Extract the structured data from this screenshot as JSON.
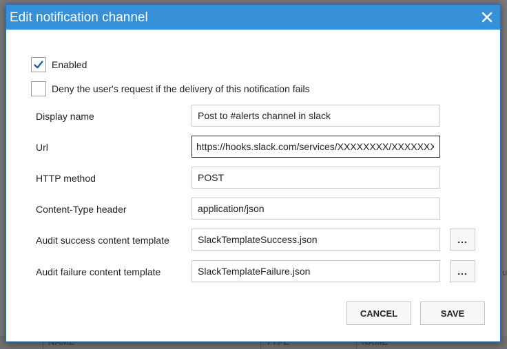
{
  "background": {
    "right_fragment": "u",
    "columns": [
      "NAME",
      "TYPE",
      "NAME"
    ]
  },
  "dialog": {
    "title": "Edit notification channel",
    "close_icon": "close-icon",
    "enabled": {
      "label": "Enabled",
      "checked": true
    },
    "deny": {
      "label": "Deny the user's request if the delivery of this notification fails",
      "checked": false
    },
    "fields": {
      "display_name": {
        "label": "Display name",
        "value": "Post to #alerts channel in slack"
      },
      "url": {
        "label": "Url",
        "value": "https://hooks.slack.com/services/XXXXXXXX/XXXXXXXXX/XXXXXXXXXXXXXXXXXXXXXXXX"
      },
      "http_method": {
        "label": "HTTP method",
        "value": "POST"
      },
      "content_type": {
        "label": "Content-Type header",
        "value": "application/json"
      },
      "success_template": {
        "label": "Audit success content template",
        "value": "SlackTemplateSuccess.json",
        "browse_label": "..."
      },
      "failure_template": {
        "label": "Audit failure content template",
        "value": "SlackTemplateFailure.json",
        "browse_label": "..."
      }
    },
    "buttons": {
      "cancel": "CANCEL",
      "save": "SAVE"
    },
    "colors": {
      "titlebar": "#3690d8",
      "checkmark": "#1e5fa8"
    }
  }
}
